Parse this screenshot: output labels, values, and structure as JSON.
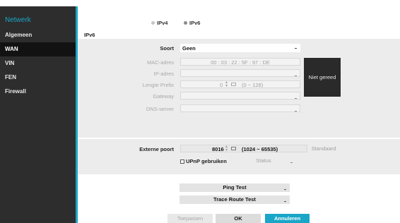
{
  "sidebar": {
    "title": "Netwerk",
    "items": [
      {
        "label": "Algemeen",
        "active": false
      },
      {
        "label": "WAN",
        "active": true
      },
      {
        "label": "VIN",
        "active": false
      },
      {
        "label": "FEN",
        "active": false
      },
      {
        "label": "Firewall",
        "active": false
      }
    ]
  },
  "ipmode": {
    "ipv4": "IPv4",
    "ipv6": "IPv6",
    "selected": "IPv6"
  },
  "section_title": "IPv6",
  "form": {
    "soort_label": "Soort",
    "soort_value": "Geen",
    "mac_label": "MAC-adres",
    "mac_value": "00 : 03 : 22 : 5F : 97 : DE",
    "ip_label": "IP-adres",
    "prefix_label": "Lengte Prefix",
    "prefix_value": "0",
    "prefix_range": "(0 ~ 128)",
    "gateway_label": "Gateway",
    "dns_label": "DNS-server",
    "status_button": "Niet gereed"
  },
  "port": {
    "label": "Externe poort",
    "value": "8016",
    "range": "(1024 ~ 65535)",
    "default_button": "Standaard",
    "upnp_label": "UPnP gebruiken",
    "status_label": "Status"
  },
  "tests": {
    "ping": "Ping Test",
    "trace": "Trace Route Test"
  },
  "actions": {
    "apply": "Toepassen",
    "ok": "OK",
    "cancel": "Annuleren"
  },
  "colors": {
    "accent": "#1aa6c7",
    "sidebar_bg": "#2d2d2d",
    "sidebar_active": "#121212",
    "status_box": "#2a2a2a"
  }
}
